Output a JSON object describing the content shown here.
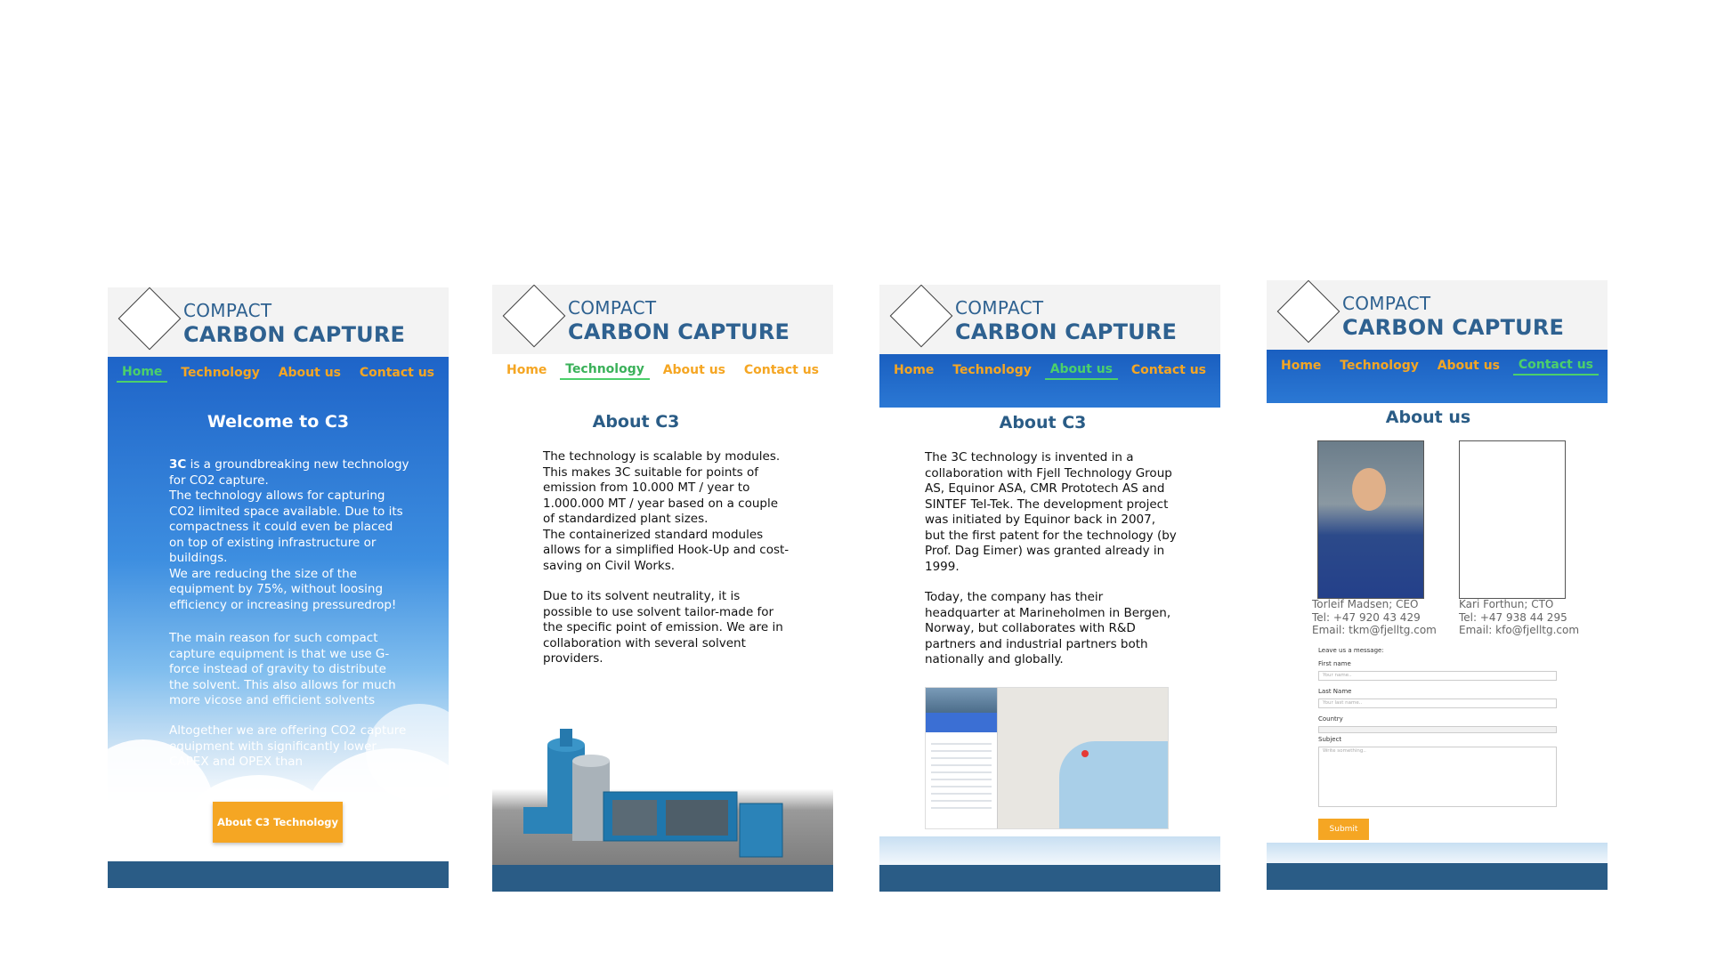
{
  "brand": {
    "line1": "COMPACT",
    "line2": "CARBON CAPTURE"
  },
  "nav": [
    "Home",
    "Technology",
    "About us",
    "Contact us"
  ],
  "screen1": {
    "title": "Welcome to C3",
    "intro_bold": "3C",
    "intro_rest": " is a groundbreaking new technology for CO2 capture.\nThe technology allows for capturing CO2 limited space available. Due to its compactness it could even be placed on top of existing infrastructure or buildings.\nWe are reducing the size of the equipment by 75%, without loosing efficiency or increasing pressuredrop!",
    "para2": "The main reason for such compact capture equipment is that we use G-force instead of gravity to distribute the solvent. This also allows for much more vicose and efficient solvents",
    "para3": "Altogether we are offering CO2 capture equipment with significantly lower CAPEX and OPEX than",
    "button": "About C3 Technology"
  },
  "screen2": {
    "title": "About C3",
    "para1": "The technology is scalable by modules. This makes 3C suitable for points of emission from 10.000 MT / year to 1.000.000 MT / year based on a couple of standardized plant sizes.\nThe containerized standard modules allows for a simplified Hook-Up and cost-saving on Civil Works.",
    "para2": "Due to its solvent neutrality, it is possible to use solvent tailor-made for the specific point of emission. We are in collaboration with several solvent providers."
  },
  "screen3": {
    "title": "About C3",
    "para1": "The 3C technology is invented in a collaboration with Fjell Technology Group AS, Equinor ASA, CMR Prototech AS and SINTEF Tel-Tek. The development project was initiated by Equinor back in 2007, but the first patent for the technology  (by Prof. Dag Eimer) was granted already in 1999.",
    "para2": "Today, the company has their headquarter at Marineholmen in Bergen, Norway, but collaborates with R&D partners and industrial partners both nationally and globally."
  },
  "screen4": {
    "title": "About us",
    "person1": "Torleif Madsen; CEO\nTel: +47 920 43 429\nEmail: tkm@fjelltg.com",
    "person2": "Kari Forthun; CTO\nTel: +47 938 44 295\nEmail: kfo@fjelltg.com",
    "form": {
      "heading": "Leave us a message:",
      "first_name": "First name",
      "first_ph": "Your name..",
      "last_name": "Last Name",
      "last_ph": "Your last name..",
      "country": "Country",
      "subject": "Subject",
      "subject_ph": "Write something..",
      "submit": "Submit"
    }
  },
  "colors": {
    "brand_blue": "#2e6190",
    "nav_orange": "#f5a623",
    "nav_active": "#4cd06a",
    "footer": "#2a5c86"
  }
}
